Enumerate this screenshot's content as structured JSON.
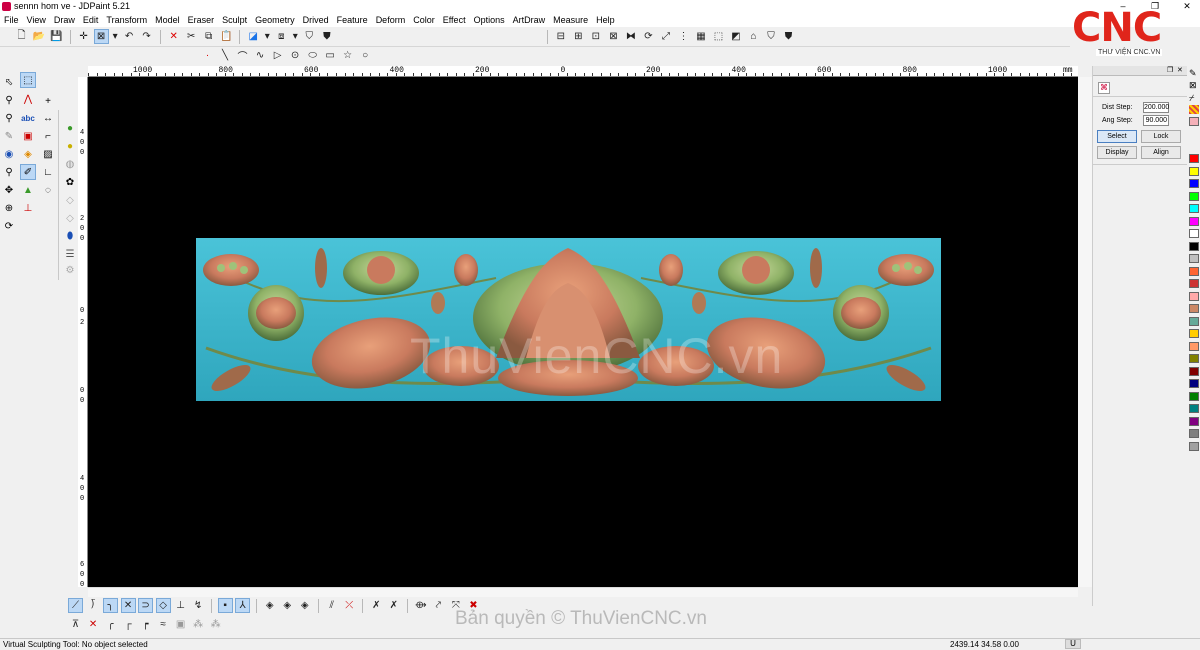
{
  "window": {
    "title": "sennn hom ve - JDPaint 5.21",
    "min": "–",
    "restore": "❐",
    "close": "✕"
  },
  "menu": [
    "File",
    "View",
    "Draw",
    "Edit",
    "Transform",
    "Model",
    "Eraser",
    "Sculpt",
    "Geometry",
    "Drived",
    "Feature",
    "Deform",
    "Color",
    "Effect",
    "Options",
    "ArtDraw",
    "Measure",
    "Help"
  ],
  "logo": {
    "text": "CNC",
    "subtitle": "THƯ VIỆN CNC.VN"
  },
  "ruler_top": {
    "labels": [
      "1000",
      "800",
      "600",
      "400",
      "200",
      "0",
      "200",
      "400",
      "600",
      "800",
      "1000"
    ],
    "unit": "mm"
  },
  "ruler_left": {
    "labels": [
      "4",
      "0",
      "0",
      "2",
      "0",
      "0",
      "0",
      "2",
      "0",
      "0",
      "4",
      "0",
      "0",
      "6",
      "0",
      "0"
    ]
  },
  "canvas": {
    "watermark": "ThuVienCNC.vn",
    "background": "#000000",
    "relief_bg": "#3fb7cc"
  },
  "panel": {
    "dist_step_label": "Dist Step:",
    "dist_step_value": "200.000",
    "ang_step_label": "Ang Step:",
    "ang_step_value": "90.000",
    "select_label": "Select",
    "lock_label": "Lock",
    "display_label": "Display",
    "align_label": "Align"
  },
  "palette": [
    "#ff0000",
    "#ffff00",
    "#0000ff",
    "#00ff00",
    "#00ffff",
    "#ff00ff",
    "#ffffff",
    "#000000",
    "#c0c0c0",
    "#ff6633",
    "#cc3333",
    "#ffaaaa",
    "#cc8866",
    "#66aa99",
    "#ffcc00",
    "#ff9966",
    "#808000",
    "#800000",
    "#000080",
    "#008000",
    "#008080",
    "#800080",
    "#808080",
    "#a0a0a0"
  ],
  "copyright": "Bản quyền © ThuVienCNC.vn",
  "status": {
    "message": "Virtual Sculpting Tool: No object selected",
    "coords": "2439.14 34.58 0.00",
    "mode": "U"
  }
}
